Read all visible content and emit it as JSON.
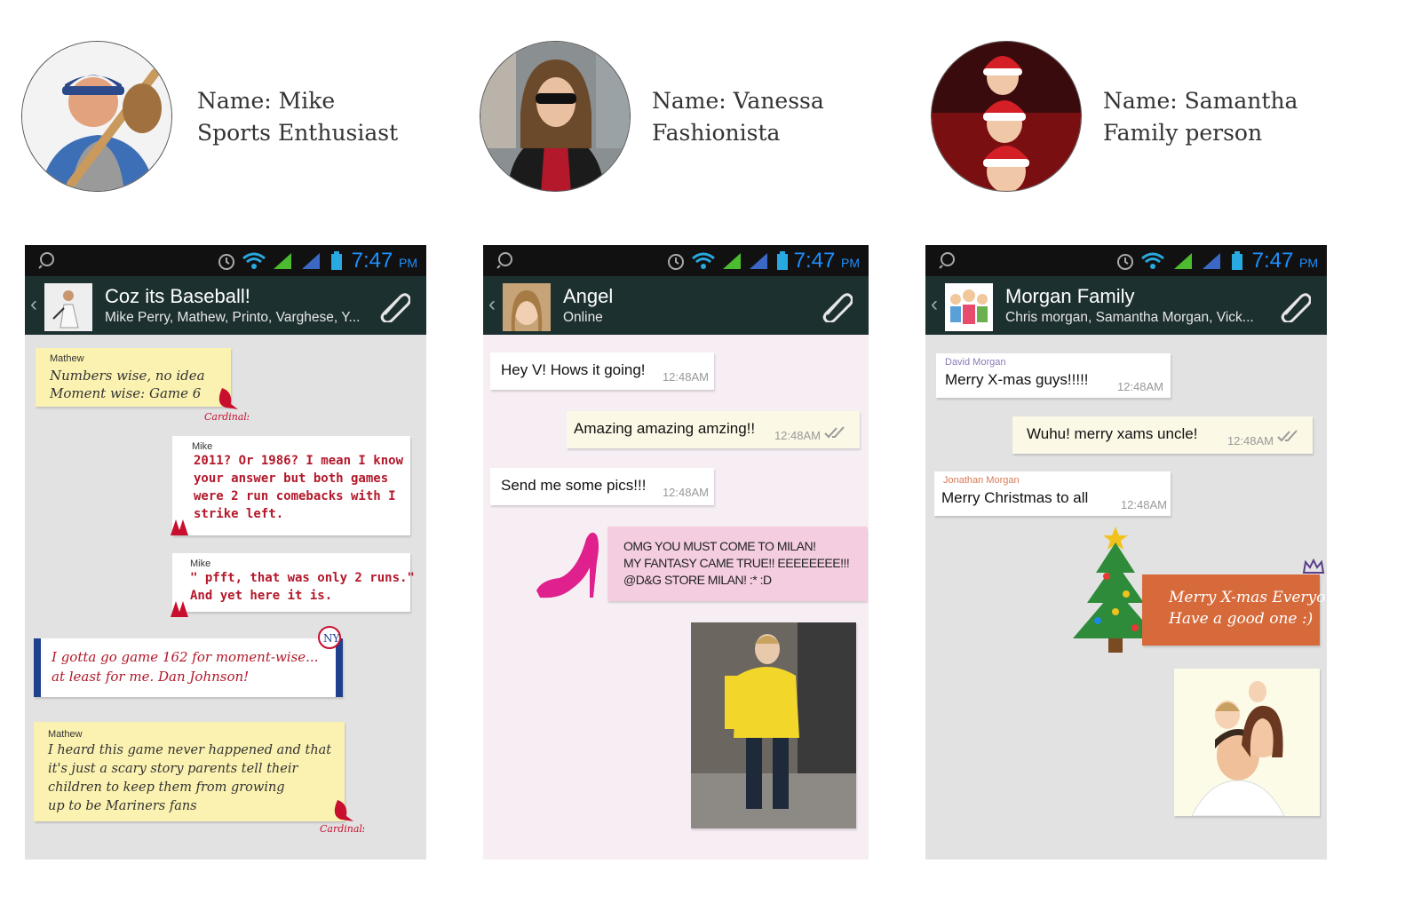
{
  "personas": [
    {
      "name": "Name: Mike",
      "role": "Sports Enthusiast"
    },
    {
      "name": "Name: Vanessa",
      "role": "Fashionista"
    },
    {
      "name": "Name: Samantha",
      "role": "Family person"
    }
  ],
  "phones": [
    {
      "status_time": "7:47",
      "status_ampm": "PM",
      "title": "Coz its Baseball!",
      "subtitle": "Mike Perry, Mathew, Printo, Varghese, Y...",
      "messages": [
        {
          "sender": "Mathew",
          "lines": [
            "Numbers wise, no idea",
            "Moment wise: Game 6"
          ]
        },
        {
          "sender": "Mike",
          "lines": [
            "2011? Or 1986? I mean I know",
            "your answer but both games",
            "were 2 run comebacks with I",
            "strike left."
          ]
        },
        {
          "sender": "Mike",
          "lines": [
            "\" pfft, that was only 2 runs.\"",
            "And yet here it is."
          ]
        },
        {
          "lines": [
            "I gotta go game 162 for moment-wise...",
            "at least for me. Dan Johnson!"
          ]
        },
        {
          "sender": "Mathew",
          "lines": [
            "I heard this game never happened and that",
            "it's just a scary story parents tell their",
            "children to keep them from growing",
            "up to be Mariners fans"
          ]
        }
      ],
      "sticker_text": "Cardinals"
    },
    {
      "status_time": "7:47",
      "status_ampm": "PM",
      "title": "Angel",
      "subtitle": "Online",
      "messages": [
        {
          "text": "Hey V! Hows it going!",
          "time": "12:48AM"
        },
        {
          "text": "Amazing amazing amzing!!",
          "time": "12:48AM"
        },
        {
          "text": "Send me some pics!!!",
          "time": "12:48AM"
        },
        {
          "lines": [
            "OMG YOU MUST COME TO MILAN!",
            "MY FANTASY CAME TRUE!! EEEEEEEE!!!",
            "@D&G STORE MILAN! :* :D"
          ]
        }
      ]
    },
    {
      "status_time": "7:47",
      "status_ampm": "PM",
      "title": "Morgan Family",
      "subtitle": "Chris morgan, Samantha Morgan, Vick...",
      "messages": [
        {
          "sender": "David Morgan",
          "text": "Merry X-mas guys!!!!!",
          "time": "12:48AM"
        },
        {
          "text": "Wuhu! merry xams uncle!",
          "time": "12:48AM"
        },
        {
          "sender": "Jonathan Morgan",
          "text": "Merry Christmas to all",
          "time": "12:48AM"
        },
        {
          "lines": [
            "Merry X-mas Everyone!",
            "Have a good one :)"
          ]
        }
      ]
    }
  ],
  "colors": {
    "titlebar": "#1d3030",
    "statusbar": "#111111",
    "clock": "#1e90ff",
    "chat_bg_1": "#e2e2e2",
    "chat_bg_2": "#f7eef4",
    "chat_bg_3": "#e2e2e2",
    "note_yellow": "#fbf2b1",
    "red_text": "#b3182b",
    "pink_bubble": "#f4cde0",
    "orange_bubble": "#d66a3a"
  }
}
